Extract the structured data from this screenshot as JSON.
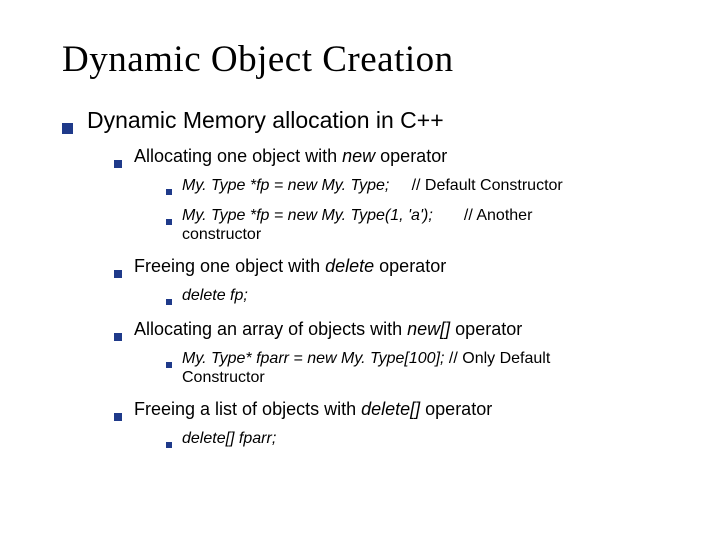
{
  "title": "Dynamic Object Creation",
  "h1": "Dynamic Memory allocation in C++",
  "sec1": {
    "head_a": "Allocating one object with ",
    "head_kw": "new",
    "head_b": " operator",
    "line1_code": "My. Type *fp = new My. Type;",
    "line1_gap": "     ",
    "line1_cmt": "// Default Constructor",
    "line2_code": "My. Type *fp = new My. Type(1, 'a');",
    "line2_gap": "       ",
    "line2_cmt": "// Another",
    "line2_cont": "constructor"
  },
  "sec2": {
    "head_a": "Freeing one object with ",
    "head_kw": "delete",
    "head_b": " operator",
    "line1": "delete fp;"
  },
  "sec3": {
    "head_a": "Allocating an array of objects with ",
    "head_kw": "new[]",
    "head_b": " operator",
    "line1_code": "My. Type* fparr = new My. Type[100]; ",
    "line1_cmt": "// Only Default",
    "line1_cont": "Constructor"
  },
  "sec4": {
    "head_a": "Freeing a list of objects with ",
    "head_kw": "delete[]",
    "head_b": " operator",
    "line1": "delete[] fparr;"
  }
}
